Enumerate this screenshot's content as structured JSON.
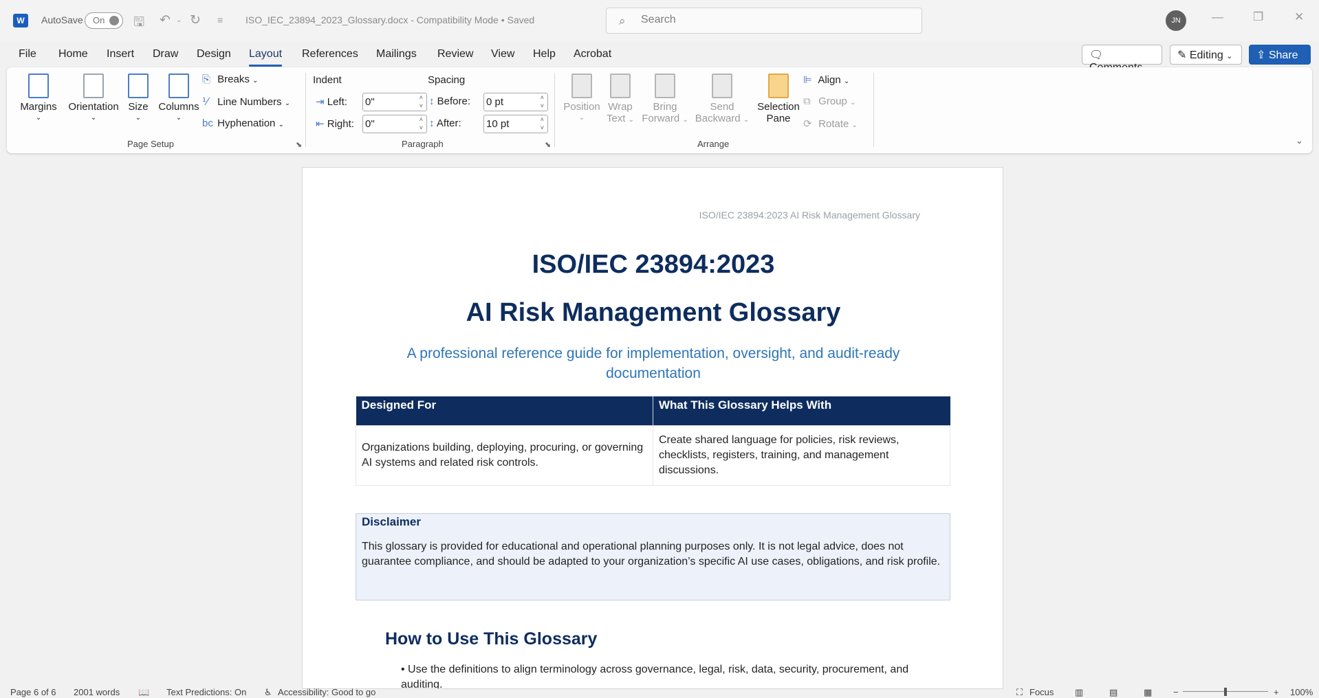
{
  "titlebar": {
    "autosave_label": "AutoSave",
    "autosave_state": "On",
    "doc_title": "ISO_IEC_23894_2023_Glossary.docx  -  Compatibility Mode  •  Saved",
    "search_placeholder": "Search",
    "user_initials": "JN"
  },
  "menu": {
    "tabs": [
      "File",
      "Home",
      "Insert",
      "Draw",
      "Design",
      "Layout",
      "References",
      "Mailings",
      "Review",
      "View",
      "Help",
      "Acrobat"
    ],
    "active_tab": "Layout",
    "comments_label": "Comments",
    "editing_label": "Editing",
    "share_label": "Share"
  },
  "ribbon": {
    "page_setup": {
      "margins": "Margins",
      "orientation": "Orientation",
      "size": "Size",
      "columns": "Columns",
      "breaks": "Breaks",
      "line_numbers": "Line Numbers",
      "hyphenation": "Hyphenation",
      "group_label": "Page Setup"
    },
    "paragraph": {
      "indent_label": "Indent",
      "spacing_label": "Spacing",
      "left_label": "Left:",
      "left_value": "0\"",
      "right_label": "Right:",
      "right_value": "0\"",
      "before_label": "Before:",
      "before_value": "0 pt",
      "after_label": "After:",
      "after_value": "10 pt",
      "group_label": "Paragraph"
    },
    "arrange": {
      "position": "Position",
      "wrap_text_1": "Wrap",
      "wrap_text_2": "Text",
      "bring_forward_1": "Bring",
      "bring_forward_2": "Forward",
      "send_backward_1": "Send",
      "send_backward_2": "Backward",
      "selection_pane_1": "Selection",
      "selection_pane_2": "Pane",
      "align": "Align",
      "group": "Group",
      "rotate": "Rotate",
      "group_label": "Arrange"
    }
  },
  "document": {
    "header_text": "ISO/IEC 23894:2023 AI Risk Management Glossary",
    "title_line1": "ISO/IEC 23894:2023",
    "title_line2": "AI Risk Management Glossary",
    "subtitle": "A professional reference guide for implementation, oversight, and audit-ready documentation",
    "table": {
      "headers": [
        "Designed For",
        "What This Glossary Helps With"
      ],
      "rows": [
        [
          "Organizations building, deploying, procuring, or governing AI systems and related risk controls.",
          "Create shared language for policies, risk reviews, checklists, registers, training, and management discussions."
        ]
      ]
    },
    "disclaimer_title": "Disclaimer",
    "disclaimer_body": "This glossary is provided for educational and operational planning purposes only. It is not legal advice, does not guarantee compliance, and should be adapted to your organization’s specific AI use cases, obligations, and risk profile.",
    "section_heading": "How to Use This Glossary",
    "bullet_1": "• Use the definitions to align terminology across governance, legal, risk, data, security, procurement, and auditing."
  },
  "statusbar": {
    "page": "Page 6 of 6",
    "words": "2001 words",
    "text_predictions": "Text Predictions: On",
    "accessibility": "Accessibility: Good to go",
    "focus": "Focus",
    "zoom": "100%"
  },
  "colors": {
    "accent": "#1f5fb4",
    "heading_navy": "#0e2d5e",
    "subtitle_blue": "#2e75b6",
    "disclaimer_bg": "#edf1f9"
  }
}
